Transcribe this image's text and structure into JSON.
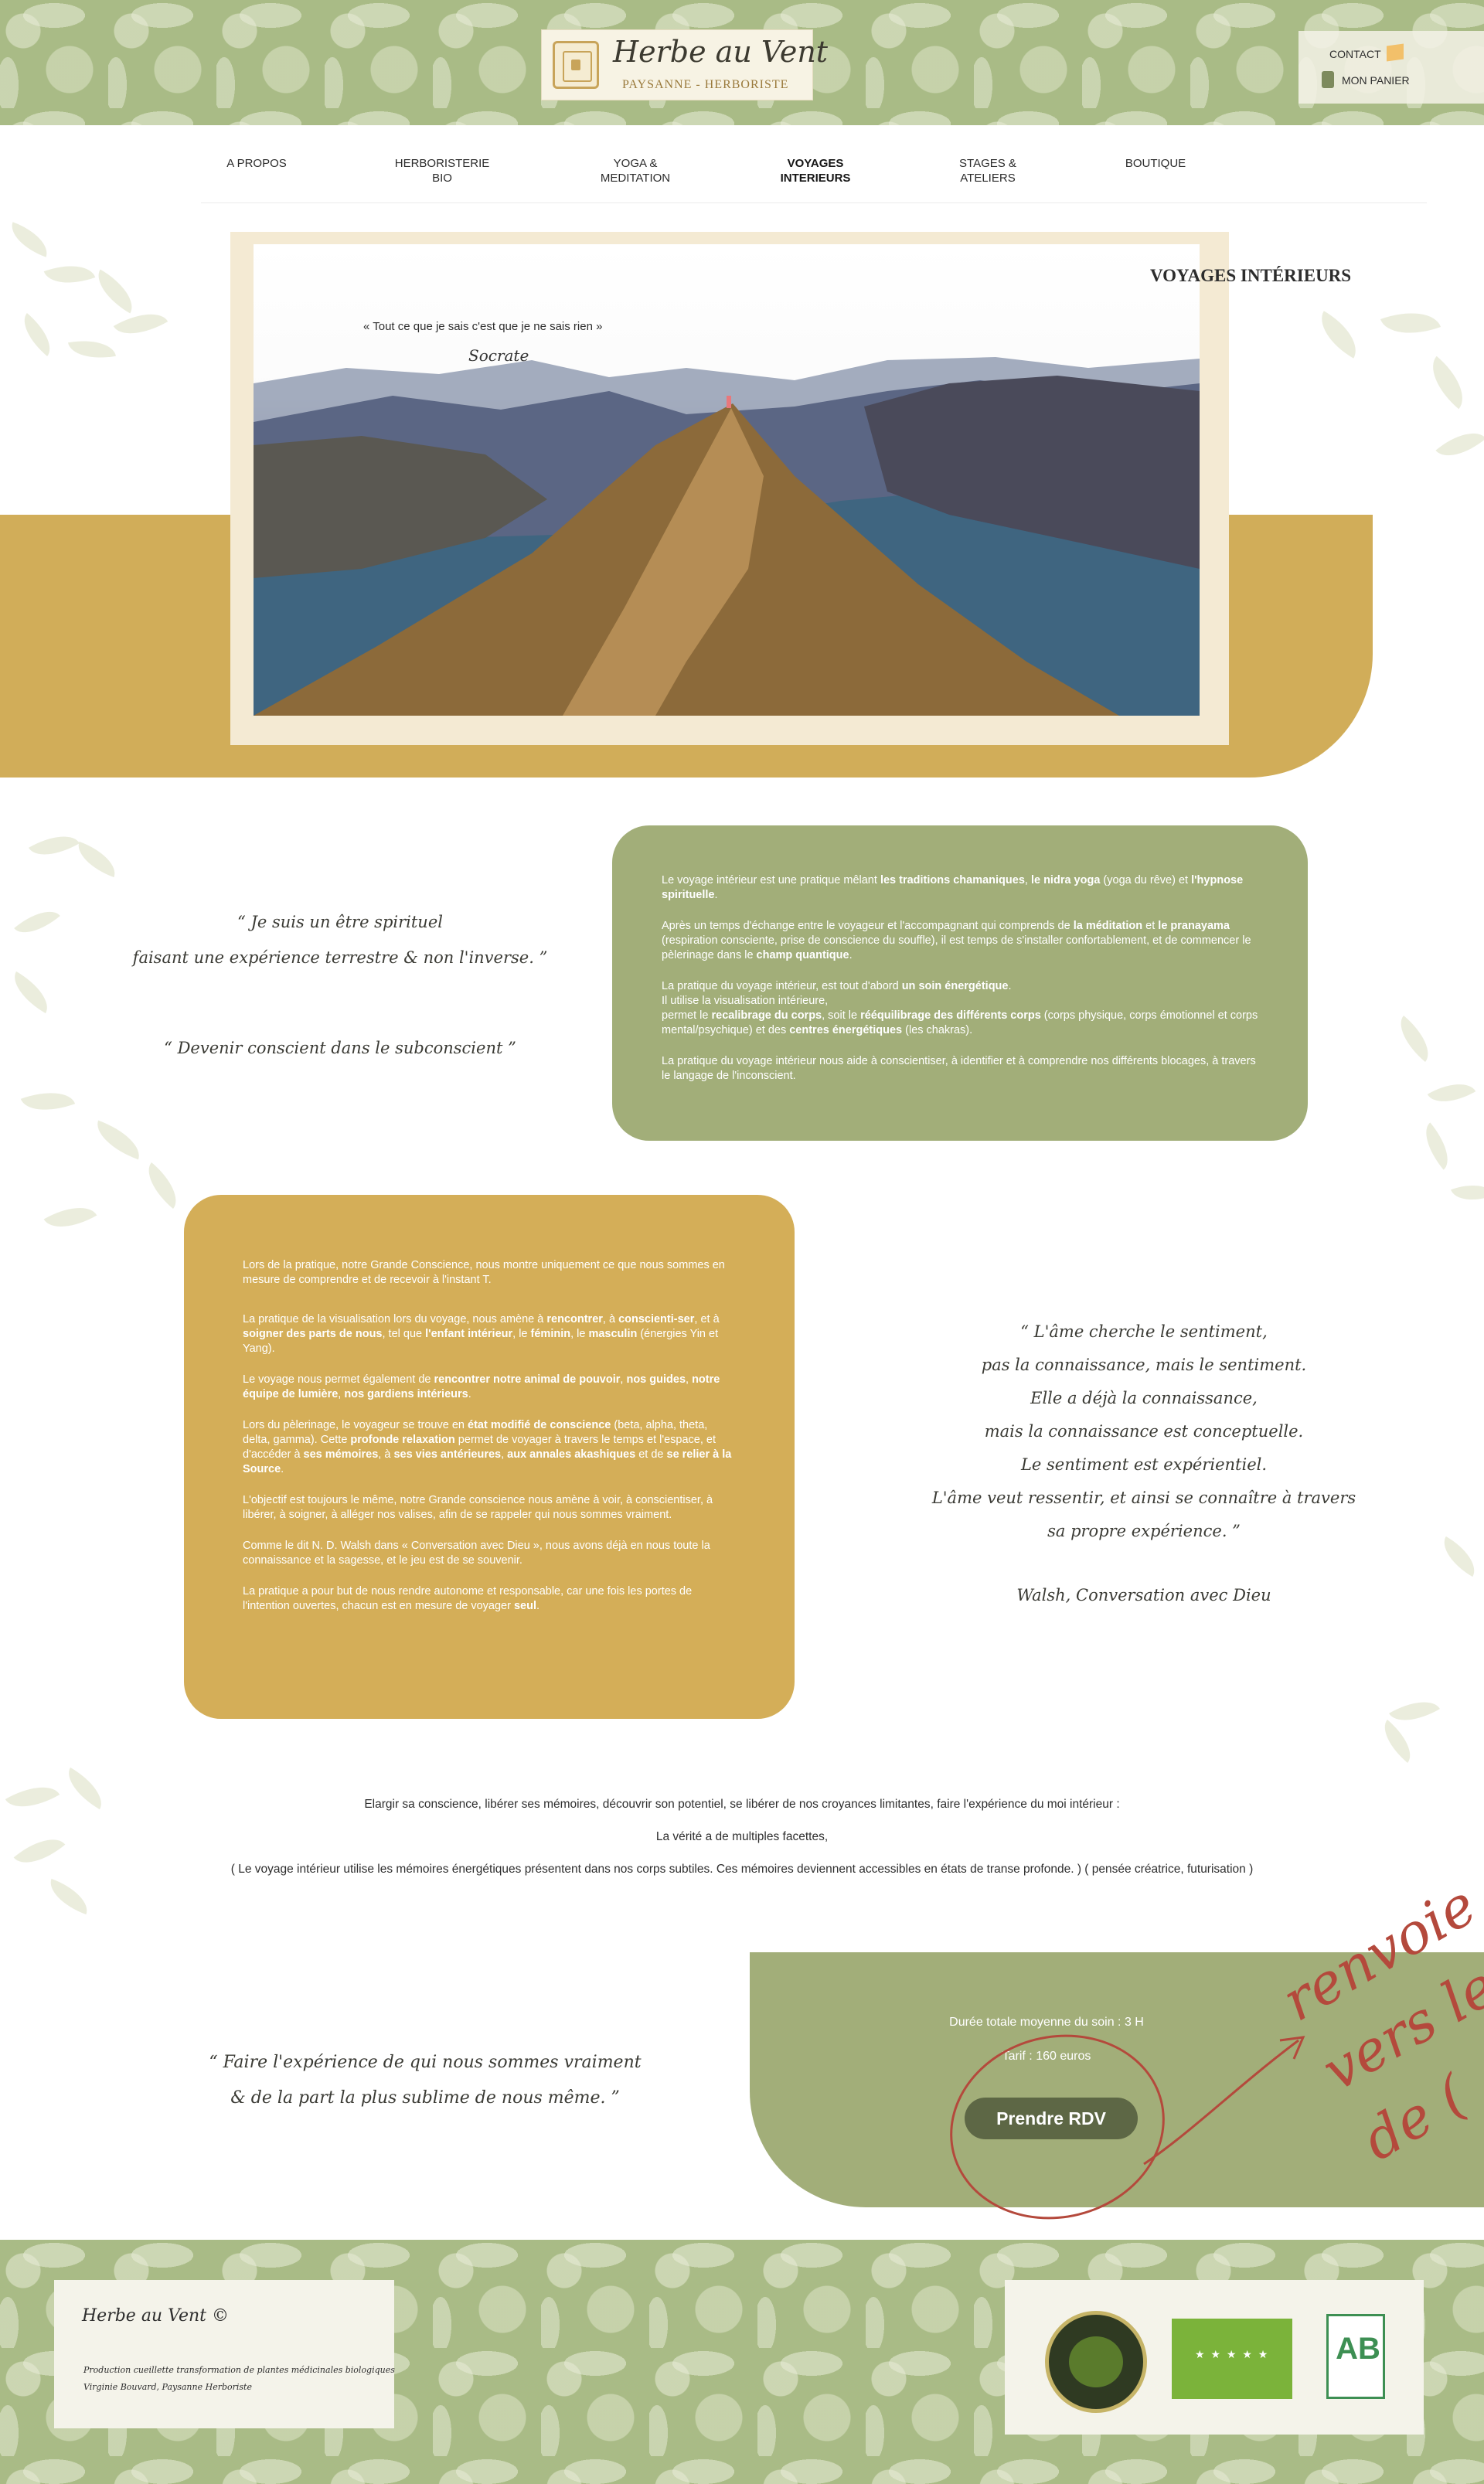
{
  "header": {
    "logo_title": "Herbe au Vent",
    "logo_subtitle": "PAYSANNE - HERBORISTE",
    "contact_label": "CONTACT",
    "cart_label": "MON PANIER"
  },
  "nav": {
    "items": [
      {
        "label": "A PROPOS"
      },
      {
        "label": "HERBORISTERIE\nBIO"
      },
      {
        "label": "YOGA &\nMEDITATION"
      },
      {
        "label": "VOYAGES\nINTERIEURS"
      },
      {
        "label": "STAGES &\nATELIERS"
      },
      {
        "label": "BOUTIQUE"
      }
    ],
    "active": "VOYAGES INTERIEURS"
  },
  "hero": {
    "quote": "« Tout ce que je sais c'est que je ne sais rien »",
    "author": "Socrate",
    "page_title": "VOYAGES INTÉRIEURS"
  },
  "quotes_left": {
    "q1_line1": "“ Je suis un être spirituel",
    "q1_line2": "faisant une expérience terrestre & non l'inverse. ”",
    "q2": "“ Devenir conscient dans le subconscient ”"
  },
  "green_box": {
    "p1": "Le voyage intérieur est une pratique mêlant <b>les traditions chamaniques</b>, <b>le nidra yoga</b> (yoga du rêve) et <b>l'hypnose spirituelle</b>.",
    "p2": "Après un temps d'échange entre le voyageur et l'accompagnant qui comprends de <b>la méditation</b> et <b>le pranayama</b> (respiration consciente, prise de conscience du souffle), il est temps de s'installer confortablement, et de commencer le pèlerinage dans le <b>champ quantique</b>.",
    "p3": "La pratique du voyage intérieur, est tout d'abord <b>un soin énergétique</b>.<br>Il utilise la visualisation intérieure,<br>permet le <b>recalibrage du corps</b>, soit le <b>rééquilibrage des différents corps</b> (corps physique, corps émotionnel et corps mental/psychique) et des <b>centres énergétiques</b> (les chakras).",
    "p4": "La pratique du voyage intérieur nous aide à conscientiser, à identifier et à comprendre nos différents blocages, à travers le langage de l'inconscient."
  },
  "gold_box": {
    "p1": "Lors de la pratique, notre Grande Conscience, nous montre uniquement ce que nous sommes en mesure de comprendre et de recevoir à l'instant T.",
    "p2": "La pratique de la visualisation lors du voyage, nous amène à <b>rencontrer</b>, à <b>conscienti-ser</b>, et à <b>soigner des parts de nous</b>, tel que <b>l'enfant intérieur</b>, le <b>féminin</b>, le <b>masculin</b> (énergies Yin et Yang).",
    "p3": "Le voyage nous permet également de <b>rencontrer notre animal de pouvoir</b>, <b>nos guides</b>, <b>notre équipe de lumière</b>, <b>nos gardiens intérieurs</b>.",
    "p4": "Lors du pèlerinage, le voyageur se trouve en <b>état modifié de conscience</b> (beta, alpha, theta, delta, gamma). Cette <b>profonde relaxation</b> permet de voyager à travers le temps et l'espace, et d'accéder à <b>ses mémoires</b>, à <b>ses vies antérieures</b>, <b>aux annales akashiques</b> et de <b>se relier à la Source</b>.",
    "p5": "L'objectif est toujours le même, notre Grande conscience nous amène à voir, à conscientiser, à libérer, à soigner, à alléger nos valises, afin de se rappeler qui nous sommes vraiment.",
    "p6": "Comme le dit N. D. Walsh dans « Conversation avec Dieu », nous avons déjà en nous toute la connaissance et la sagesse, et le jeu est de se souvenir.",
    "p7": "La pratique a pour but de nous rendre autonome et responsable, car une fois les portes de l'intention ouvertes, chacun est en mesure de voyager <b>seul</b>."
  },
  "walsh_quote": {
    "lines": [
      "“ L'âme cherche le sentiment,",
      "pas la connaissance, mais le sentiment.",
      "Elle a déjà la connaissance,",
      "mais la connaissance est conceptuelle.",
      "Le sentiment est expérientiel.",
      "L'âme veut ressentir, et ainsi se connaître à travers",
      "sa propre expérience. ”"
    ],
    "signature": "Walsh, Conversation avec Dieu"
  },
  "mid_text": {
    "line1": "Elargir sa conscience, libérer ses mémoires, découvrir son potentiel, se libérer de nos croyances limitantes, faire l'expérience du moi intérieur :",
    "line2": "La vérité a de multiples facettes,",
    "line3": "( Le voyage intérieur utilise les mémoires énergétiques présentent dans nos corps subtiles. Ces mémoires deviennent accessibles en états de transe profonde. ) ( pensée créatrice, futurisation )"
  },
  "bottom_quote": {
    "line1": "“ Faire l'expérience de qui nous sommes vraiment",
    "line2": "& de la part la plus sublime de nous même. ”"
  },
  "booking": {
    "duration": "Durée totale moyenne du soin : 3 H",
    "price": "Tarif : 160 euros",
    "button": "Prendre RDV",
    "annotation": "renvoie\nvers le\nde ("
  },
  "footer": {
    "title": "Herbe au Vent ©",
    "note1": "Production cueillette transformation de plantes médicinales biologiques",
    "note2": "Virginie Bouvard, Paysanne Herboriste",
    "badges": [
      "Reserve Suisse Normande Territoire Préservé",
      "EU organic",
      "AB Agriculture Biologique"
    ],
    "ab_label": "AB"
  },
  "colors": {
    "sage": "#a2ae79",
    "gold": "#d4ae58",
    "floral": "#a9bb86",
    "annotation_red": "#b4493c"
  }
}
